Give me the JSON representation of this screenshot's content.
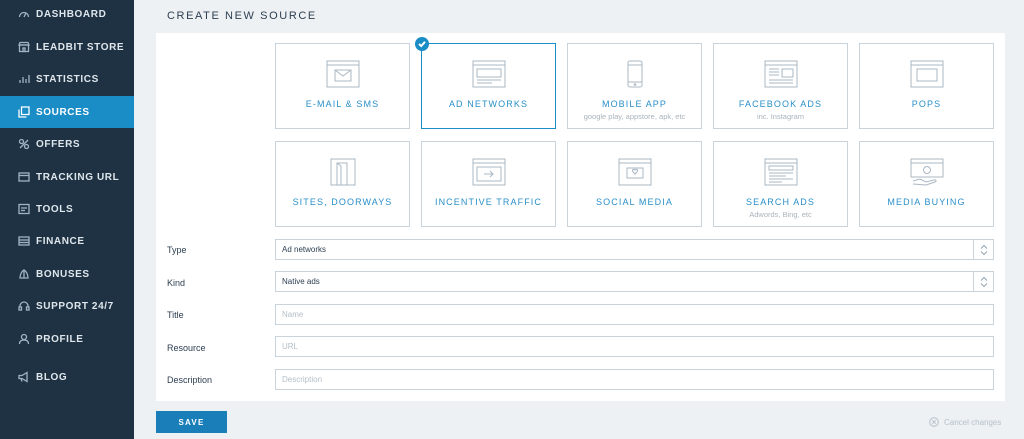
{
  "sidebar": {
    "items": [
      {
        "label": "DASHBOARD",
        "icon": "dashboard-icon"
      },
      {
        "label": "LEADBIT STORE",
        "icon": "store-icon"
      },
      {
        "label": "STATISTICS",
        "icon": "statistics-icon"
      },
      {
        "label": "SOURCES",
        "icon": "sources-icon",
        "active": true
      },
      {
        "label": "OFFERS",
        "icon": "offers-icon"
      },
      {
        "label": "TRACKING URL",
        "icon": "tracking-icon"
      },
      {
        "label": "TOOLS",
        "icon": "tools-icon"
      },
      {
        "label": "FINANCE",
        "icon": "finance-icon"
      },
      {
        "label": "BONUSES",
        "icon": "bonuses-icon"
      },
      {
        "label": "SUPPORT 24/7",
        "icon": "support-icon"
      },
      {
        "label": "PROFILE",
        "icon": "profile-icon"
      },
      {
        "label": "BLOG",
        "icon": "blog-icon"
      }
    ]
  },
  "page": {
    "title": "CREATE NEW SOURCE"
  },
  "tiles": [
    {
      "label": "E-MAIL & SMS",
      "sub": "",
      "icon": "email-icon"
    },
    {
      "label": "AD NETWORKS",
      "sub": "",
      "icon": "ad-networks-icon",
      "selected": true
    },
    {
      "label": "MOBILE APP",
      "sub": "google play, appstore, apk, etc",
      "icon": "mobile-app-icon"
    },
    {
      "label": "FACEBOOK ADS",
      "sub": "inc. Instagram",
      "icon": "facebook-ads-icon"
    },
    {
      "label": "POPS",
      "sub": "",
      "icon": "pops-icon"
    },
    {
      "label": "SITES, DOORWAYS",
      "sub": "",
      "icon": "sites-icon"
    },
    {
      "label": "INCENTIVE TRAFFIC",
      "sub": "",
      "icon": "incentive-icon"
    },
    {
      "label": "SOCIAL MEDIA",
      "sub": "",
      "icon": "social-icon"
    },
    {
      "label": "SEARCH ADS",
      "sub": "Adwords, Bing, etc",
      "icon": "search-ads-icon"
    },
    {
      "label": "MEDIA BUYING",
      "sub": "",
      "icon": "media-buying-icon"
    }
  ],
  "form": {
    "type": {
      "label": "Type",
      "value": "Ad networks"
    },
    "kind": {
      "label": "Kind",
      "value": "Native ads"
    },
    "title": {
      "label": "Title",
      "placeholder": "Name",
      "value": ""
    },
    "resource": {
      "label": "Resource",
      "placeholder": "URL",
      "value": ""
    },
    "description": {
      "label": "Description",
      "placeholder": "Description",
      "value": ""
    }
  },
  "actions": {
    "save_label": "SAVE",
    "cancel_label": "Cancel changes"
  },
  "colors": {
    "sidebar_bg": "#1e3243",
    "accent": "#1a8cc6",
    "save_bg": "#1a7fb8"
  }
}
